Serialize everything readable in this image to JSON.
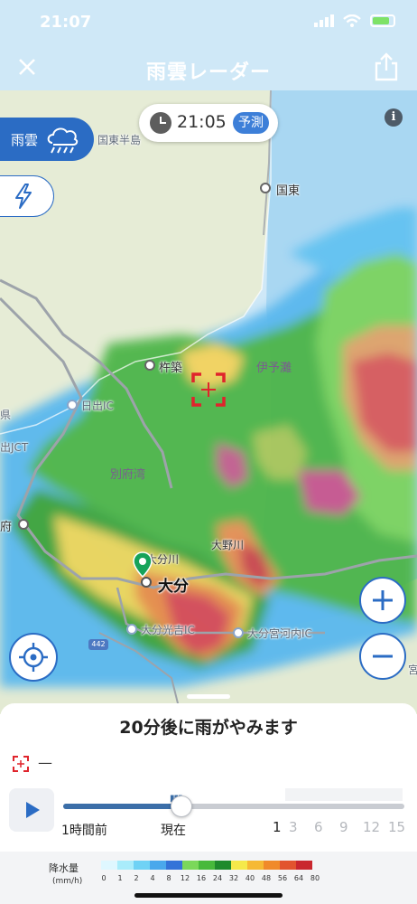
{
  "status": {
    "time": "21:07"
  },
  "header": {
    "title": "雨雲レーダー",
    "close_icon": "close-icon",
    "share_icon": "share-icon"
  },
  "time_display": {
    "time": "21:05",
    "badge": "予測"
  },
  "info": {
    "label": "i"
  },
  "layers": {
    "rain_label": "雨雲",
    "rain_icon": "rain-cloud-icon",
    "lightning_icon": "lightning-icon"
  },
  "map_labels": {
    "kunisaki_peninsula": "国東半島",
    "kunisaki": "国東",
    "kitsuki": "杵築",
    "iyonada": "伊予灘",
    "hiji_ic": "日出IC",
    "hiji_jct": "出JCT",
    "fu": "府",
    "beppu_bay": "別府湾",
    "oita": "大分",
    "oita_river": "大分川",
    "ono_river": "大野川",
    "oita_mitsuyoshi_ic": "大分光吉IC",
    "oita_miyagawachi_ic": "大分宮河内IC",
    "edge_ken": "県",
    "edge_kai": "宮",
    "route_442": "442"
  },
  "sheet": {
    "message": "20分後に雨がやみます",
    "target_value": "—",
    "timeline": {
      "label_start": "1時間前",
      "label_now": "現在",
      "ticks": [
        "1",
        "3",
        "6",
        "9",
        "12",
        "15"
      ],
      "active_tick": "1",
      "progress": 0.35
    }
  },
  "legend": {
    "title": "降水量",
    "unit": "(mm/h)",
    "values": [
      "0",
      "1",
      "2",
      "4",
      "8",
      "12",
      "16",
      "24",
      "32",
      "40",
      "48",
      "56",
      "64",
      "80"
    ],
    "colors": [
      "#dff7ff",
      "#a9ecfb",
      "#6fd2f5",
      "#4aa8ec",
      "#3473d8",
      "#7bd85a",
      "#47b93b",
      "#1e8a2c",
      "#f5e94a",
      "#f6b934",
      "#f08a2a",
      "#e2542e",
      "#c9272e"
    ]
  }
}
